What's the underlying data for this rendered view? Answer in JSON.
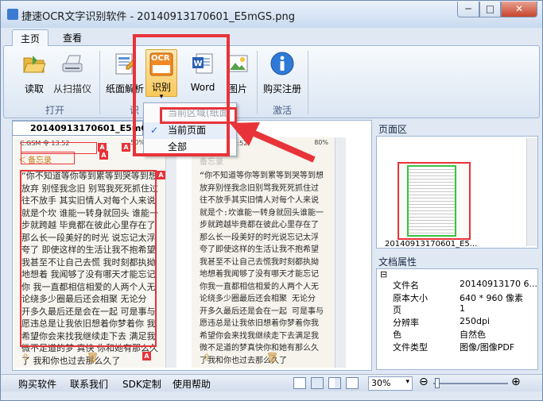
{
  "window": {
    "title": "捷速OCR文字识别软件 - 20140913170601_E5mGS.png",
    "min_label": "─",
    "max_label": "□",
    "close_label": "✕"
  },
  "tabs": [
    {
      "label": "主页"
    },
    {
      "label": "查看"
    }
  ],
  "ribbon": {
    "buttons": [
      {
        "label": "读取",
        "icon": "folder-open-icon"
      },
      {
        "label": "从扫描仪",
        "icon": "scanner-icon"
      },
      {
        "label": "纸面解析",
        "icon": "page-parse-icon"
      },
      {
        "label": "识别",
        "icon": "ocr-icon",
        "sub": "OCR",
        "arrow": "▾"
      },
      {
        "label": "Word",
        "icon": "word-icon"
      },
      {
        "label": "图片",
        "icon": "image-icon"
      },
      {
        "label": "购买注册",
        "icon": "info-icon"
      }
    ],
    "groups": [
      {
        "label": "打开"
      },
      {
        "label": "识"
      },
      {
        "label": "激活"
      }
    ]
  },
  "recognize_menu": {
    "items": [
      {
        "label": "当前区域(纸面",
        "disabled": true
      },
      {
        "label": "当前页面",
        "checked": true,
        "check": "✓"
      },
      {
        "label": "全部"
      }
    ]
  },
  "document": {
    "tab_label": "20140913170601_E5mGS.png",
    "left_page": {
      "status": "C.GSM  令     13:52",
      "battery": "50%",
      "header": "备忘录",
      "back": "＜",
      "lines": [
        "“你不知道等你等到累等到哭等到想",
        "放弃 别怪我念旧 别骂我死死抓住过",
        "往不放手 其实旧情人对每个人来说",
        "就是个坎 谁能一转身就回头 谁能一",
        "步就跨越 毕竟都在彼此心里存在了",
        "那么长一段美好的时光 说忘记太浮",
        "夸了 即使这样的生活让我不抱希望",
        "我甚至不让自己去慌 我时刻都执拗",
        "地想着 我闻够了没有哪天才能忘记",
        "你 我一直都相信相爱的人两个人无",
        "论绕多少圈最后还会相聚 无论分",
        "开多久最后还是会在一起 可是事与",
        "愿违总是让我依旧想着你梦着你 我",
        "希望你会来找我继续走下去 满足我",
        "微不足道的梦 真快 你和她有那么久",
        "了 我和你也过去那么久了"
      ]
    },
    "right_page": {
      "status": "C.GSM  令     13:52",
      "battery": "80%",
      "header": "备忘录",
      "lines": [
        "“你不知道等你等到累等到哭等到想",
        "放弃别怪我念旧别骂我死死抓住过",
        "往不放手其实旧情人对每个人来说",
        "就是个:坎谁能一转身就回头谁能一",
        "步就跨越毕竟都在彼此心里存在了",
        "那么长一段美好的时光说忘记太浮",
        "夸了即使这样的生活让我不抱希望",
        "我甚至不让自己去慌我时刻都执拗",
        "地想着我闻够了没有哪天才能忘记",
        "你我一直都相信相爱的人两个人无",
        "论绕多少圈最后还会相聚 无论分",
        "开多久最后还是会在一起 可是事与",
        "愿违总是让我依旧想着你梦着你我",
        "希望你会来找我继续走下去满足我",
        "微不足道的梦真快你和她有那么久",
        "了我和你也过去那么久了"
      ]
    }
  },
  "pages_panel": {
    "title": "页面区",
    "thumb_label": "20140913170601_E5..."
  },
  "properties_panel": {
    "title": "文档属性",
    "collapse": "⊟",
    "rows": [
      {
        "key": "文件名",
        "value": "20140913170 6..."
      },
      {
        "key": "原本大小",
        "value": "640 * 960 像素"
      },
      {
        "key": "页",
        "value": "1"
      },
      {
        "key": "分辨率",
        "value": "250dpi"
      },
      {
        "key": "色",
        "value": "自然色"
      },
      {
        "key": "文件类型",
        "value": "图像/图像PDF"
      }
    ]
  },
  "statusbar": {
    "links": [
      {
        "label": "购买软件"
      },
      {
        "label": "联系我们"
      },
      {
        "label": "SDK定制"
      },
      {
        "label": "使用帮助"
      }
    ],
    "zoom": "30%",
    "zoom_out": "⊖",
    "zoom_in": "⊕",
    "zoom_level": 0.3
  }
}
